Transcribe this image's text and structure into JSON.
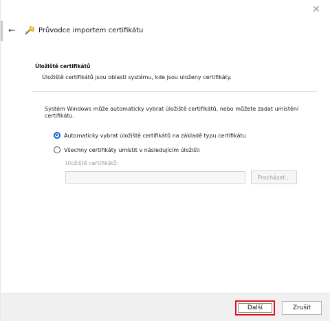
{
  "window": {
    "title": "Průvodce importem certifikátu",
    "close_glyph": "✕",
    "back_glyph": "←"
  },
  "section": {
    "heading": "Úložiště certifikátů",
    "description": "Úložiště certifikátů jsou oblasti systému, kde jsou uloženy certifikáty."
  },
  "explanation": "Systém Windows může automaticky vybrat úložiště certifikátů, nebo můžete zadat umístění certifikátu.",
  "options": [
    {
      "label": "Automaticky vybrat úložiště certifikátů na základě typu certifikátu",
      "selected": true
    },
    {
      "label": "Všechny certifikáty umístit v následujícím úložišti",
      "selected": false
    }
  ],
  "store": {
    "label": "Úložiště certifikátů:",
    "value": "",
    "browse_label": "Procházet..."
  },
  "footer": {
    "next_label": "Další",
    "cancel_label": "Zrušit"
  },
  "colors": {
    "accent": "#0b64c5",
    "highlight": "#e0101a",
    "footer_bg": "#f0f0f0"
  },
  "icons": {
    "wizard": "certificate-wizard-icon",
    "back": "arrow-left-icon",
    "close": "close-icon"
  }
}
